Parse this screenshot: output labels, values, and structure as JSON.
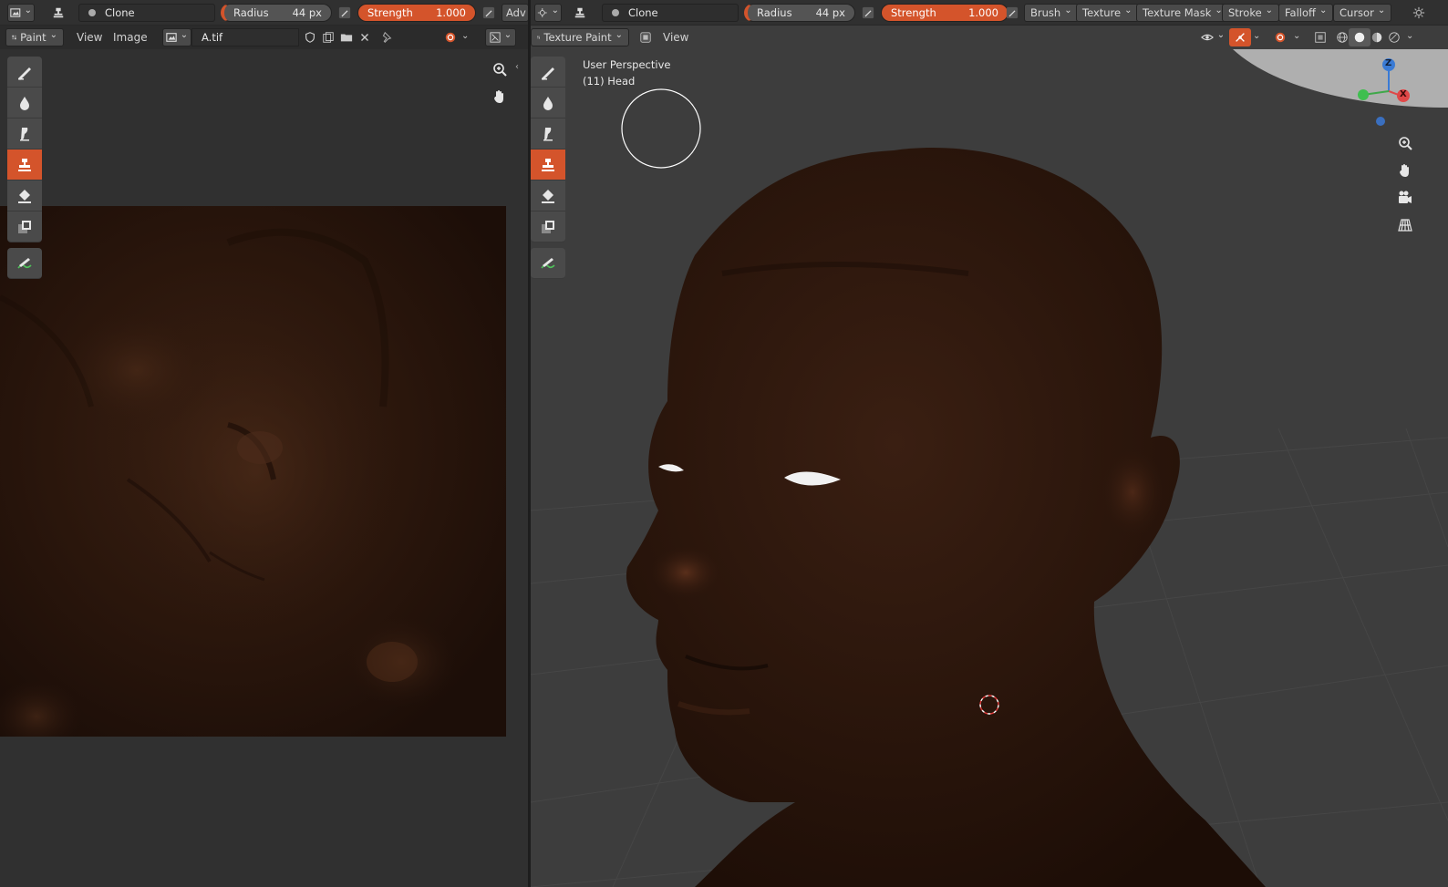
{
  "image_editor": {
    "header_row1": {
      "tool_name": "Clone",
      "radius_label": "Radius",
      "radius_value": "44 px",
      "strength_label": "Strength",
      "strength_value": "1.000",
      "advanced_label": "Adv"
    },
    "header_row2": {
      "mode_label": "Paint",
      "menus": [
        "View",
        "Image"
      ],
      "image_name": "A.tif"
    },
    "tools": [
      "brush-icon",
      "smear-icon",
      "soften-icon",
      "clone-icon",
      "fill-icon",
      "mask-icon",
      "annotate-icon"
    ],
    "active_tool_index": 3
  },
  "viewport": {
    "header_row1": {
      "tool_name": "Clone",
      "radius_label": "Radius",
      "radius_value": "44 px",
      "strength_label": "Strength",
      "strength_value": "1.000",
      "dropdowns": [
        "Brush",
        "Texture",
        "Texture Mask",
        "Stroke",
        "Falloff",
        "Cursor"
      ]
    },
    "header_row2": {
      "mode_label": "Texture Paint",
      "menus": [
        "View"
      ]
    },
    "overlay": {
      "perspective": "User Perspective",
      "object": "(11) Head"
    },
    "gizmo": {
      "z_label": "Z",
      "x_label": "X"
    },
    "tools": [
      "brush-icon",
      "smear-icon",
      "soften-icon",
      "clone-icon",
      "fill-icon",
      "mask-icon",
      "annotate-icon"
    ],
    "active_tool_index": 3
  },
  "colors": {
    "accent": "#d4542b",
    "header": "#303030",
    "viewport_bg": "#3d3d3d",
    "skin": "#2b170d"
  }
}
